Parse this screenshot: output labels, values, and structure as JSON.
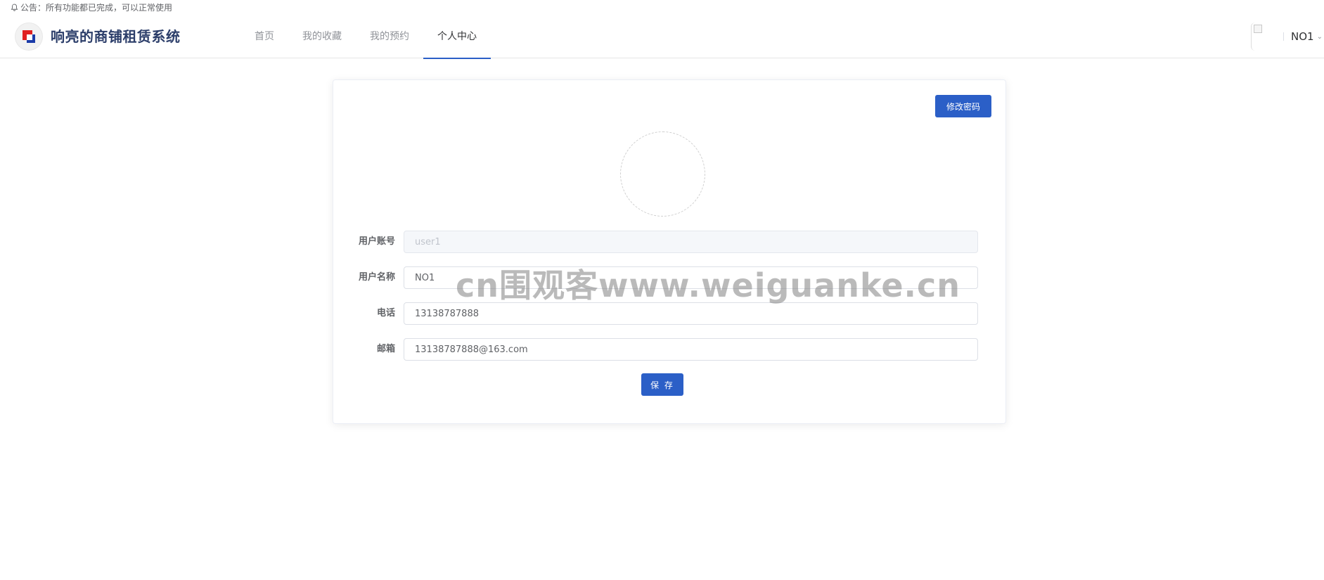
{
  "notice": {
    "text": "公告：所有功能都已完成，可以正常使用",
    "icon": "bell-icon"
  },
  "header": {
    "site_title": "响亮的商铺租赁系统",
    "logo_colors": {
      "red": "#e02020",
      "blue": "#1a3aa8"
    },
    "nav": [
      {
        "label": "首页",
        "active": false
      },
      {
        "label": "我的收藏",
        "active": false
      },
      {
        "label": "我的预约",
        "active": false
      },
      {
        "label": "个人中心",
        "active": true
      }
    ],
    "user": {
      "name": "NO1",
      "caret": "chevron-down-icon"
    }
  },
  "profile": {
    "change_password_label": "修改密码",
    "fields": {
      "account": {
        "label": "用户账号",
        "value": "user1"
      },
      "name": {
        "label": "用户名称",
        "value": "NO1"
      },
      "phone": {
        "label": "电话",
        "value": "13138787888"
      },
      "email": {
        "label": "邮箱",
        "value": "13138787888@163.com"
      }
    },
    "save_label": "保 存"
  },
  "watermark": "cn围观客www.weiguanke.cn",
  "colors": {
    "primary": "#2b5fc7"
  }
}
